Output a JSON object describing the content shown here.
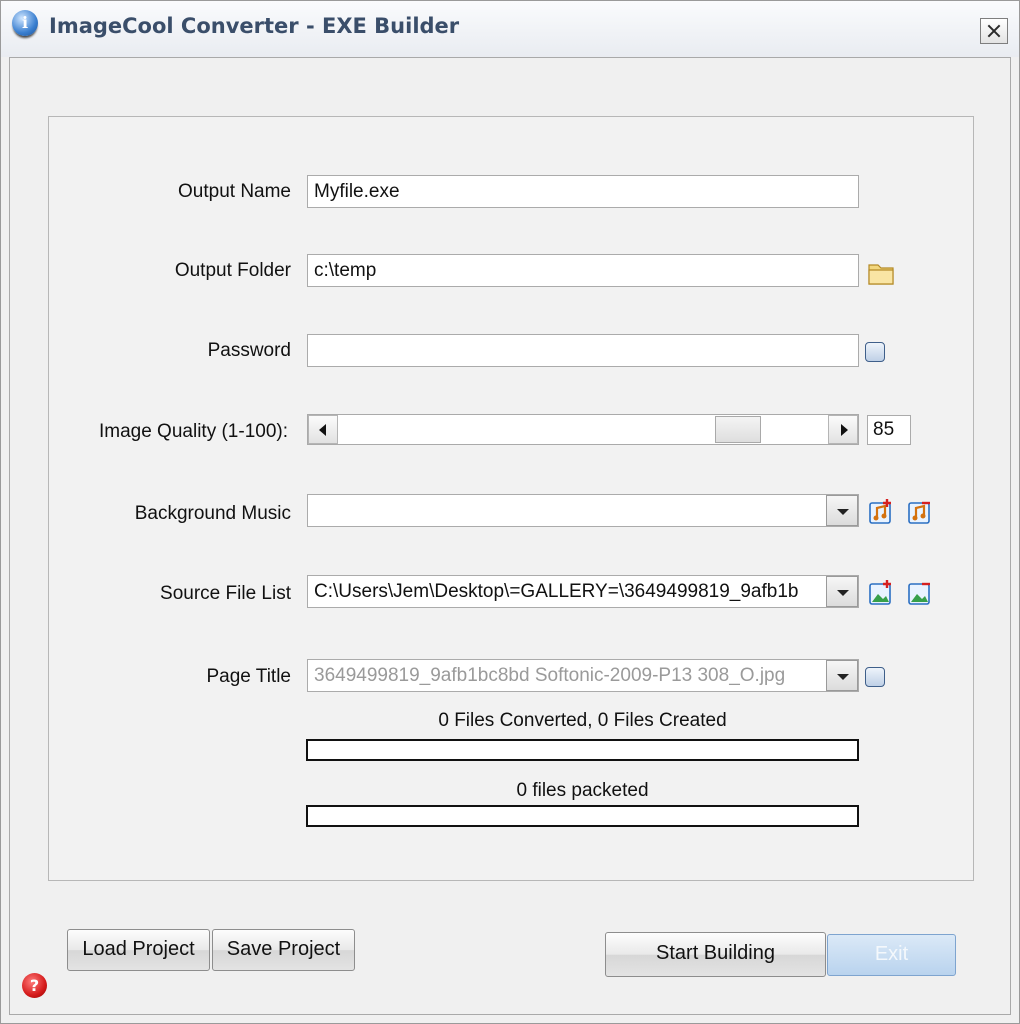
{
  "window": {
    "title": "ImageCool Converter - EXE Builder"
  },
  "form": {
    "output_name": {
      "label": "Output Name",
      "value": "Myfile.exe"
    },
    "output_folder": {
      "label": "Output Folder",
      "value": "c:\\temp"
    },
    "password": {
      "label": "Password",
      "value": ""
    },
    "image_quality": {
      "label": "Image Quality (1-100):",
      "value": "85",
      "level": 85
    },
    "background_music": {
      "label": "Background Music",
      "value": ""
    },
    "source_file_list": {
      "label": "Source File List",
      "value": "C:\\Users\\Jem\\Desktop\\=GALLERY=\\3649499819_9afb1b"
    },
    "page_title": {
      "label": "Page Title",
      "value": "3649499819_9afb1bc8bd Softonic-2009-P13 308_O.jpg"
    }
  },
  "progress": {
    "converted_text": "0 Files Converted, 0 Files Created",
    "converted_fraction": 0,
    "packeted_text": "0 files packeted",
    "packeted_fraction": 0
  },
  "buttons": {
    "load_project": "Load Project",
    "save_project": "Save Project",
    "start_building": "Start Building",
    "exit": "Exit"
  },
  "icons": {
    "app": "info-icon",
    "folder": "folder-icon",
    "music_add": "music-add-icon",
    "music_remove": "music-remove-icon",
    "image_add": "image-add-icon",
    "image_remove": "image-remove-icon",
    "help": "help-icon"
  },
  "colors": {
    "title_text": "#3a4e6a",
    "exit_button": "#b9d3ee",
    "help_red": "#d51b1b"
  }
}
